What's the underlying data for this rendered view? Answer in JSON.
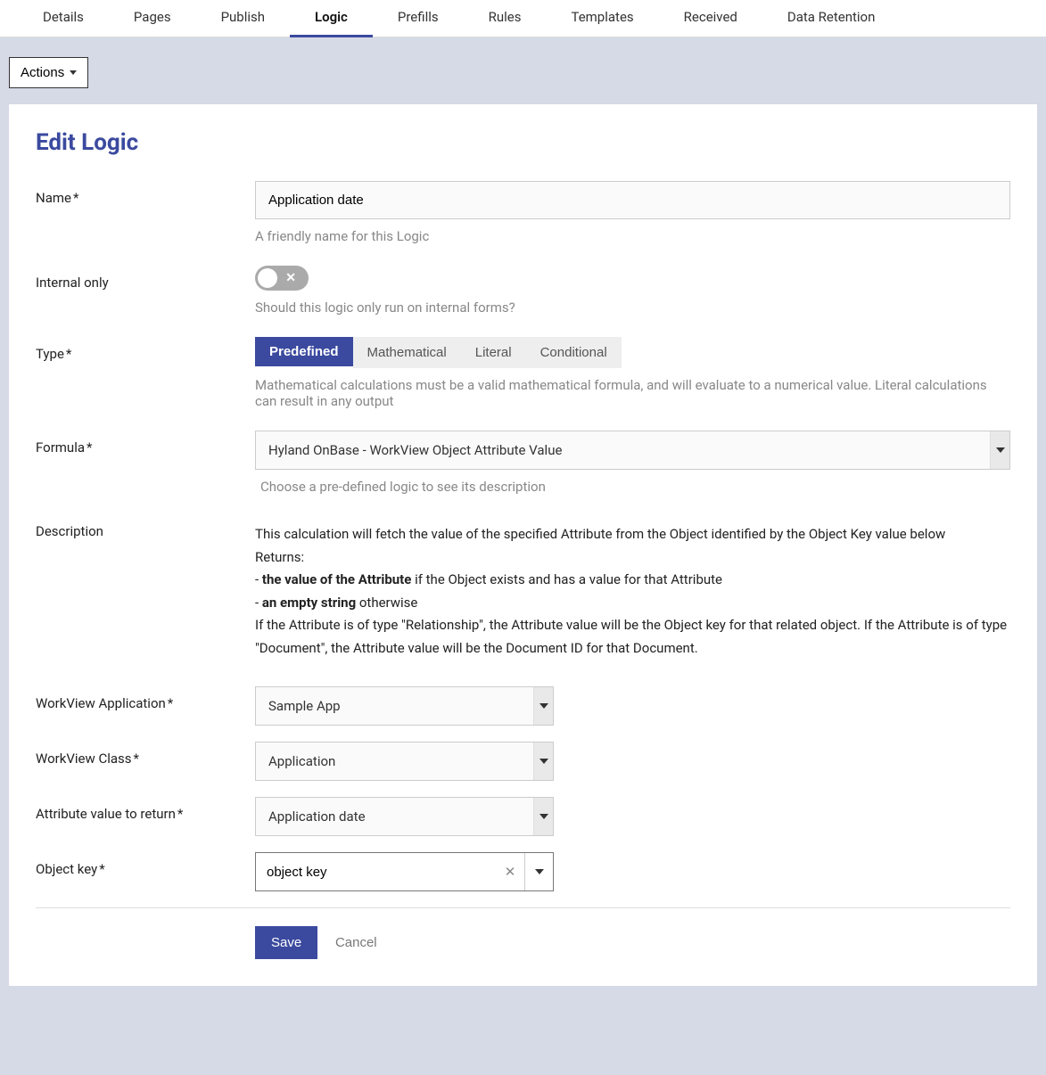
{
  "nav": {
    "tabs": [
      "Details",
      "Pages",
      "Publish",
      "Logic",
      "Prefills",
      "Rules",
      "Templates",
      "Received",
      "Data Retention"
    ],
    "active_index": 3
  },
  "actions_label": "Actions",
  "page_title": "Edit Logic",
  "fields": {
    "name": {
      "label": "Name",
      "value": "Application date",
      "helper": "A friendly name for this Logic"
    },
    "internal_only": {
      "label": "Internal only",
      "value": false,
      "off_symbol": "✕",
      "helper": "Should this logic only run on internal forms?"
    },
    "type": {
      "label": "Type",
      "options": [
        "Predefined",
        "Mathematical",
        "Literal",
        "Conditional"
      ],
      "active_index": 0,
      "helper": "Mathematical calculations must be a valid mathematical formula, and will evaluate to a numerical value. Literal calculations can result in any output"
    },
    "formula": {
      "label": "Formula",
      "value": "Hyland OnBase - WorkView Object Attribute Value",
      "helper": "Choose a pre-defined logic to see its description"
    },
    "description": {
      "label": "Description",
      "line1": "This calculation will fetch the value of the specified Attribute from the Object identified by the Object Key value below",
      "returns_label": "Returns:",
      "bullet1_bold": "the value of the Attribute",
      "bullet1_rest": " if the Object exists and has a value for that Attribute",
      "bullet2_bold": "an empty string",
      "bullet2_rest": " otherwise",
      "line_last": "If the Attribute is of type \"Relationship\", the Attribute value will be the Object key for that related object. If the Attribute is of type \"Document\", the Attribute value will be the Document ID for that Document."
    },
    "wv_app": {
      "label": "WorkView Application",
      "value": "Sample App"
    },
    "wv_class": {
      "label": "WorkView Class",
      "value": "Application"
    },
    "attr_return": {
      "label": "Attribute value to return",
      "value": "Application date"
    },
    "object_key": {
      "label": "Object key",
      "value": "object key"
    }
  },
  "buttons": {
    "save": "Save",
    "cancel": "Cancel"
  }
}
